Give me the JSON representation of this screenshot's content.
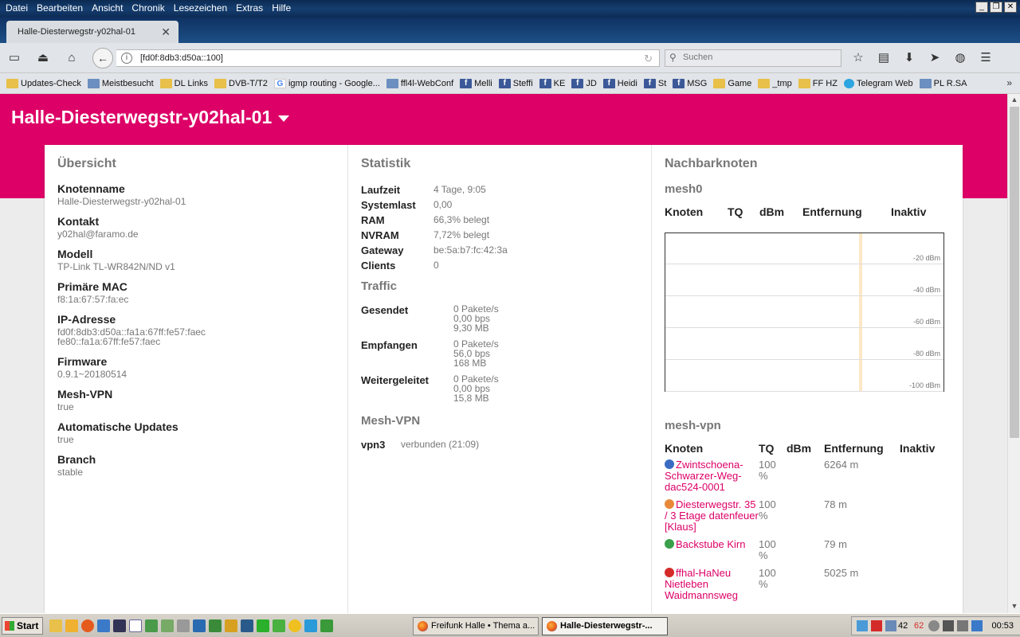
{
  "window": {
    "menu": [
      "Datei",
      "Bearbeiten",
      "Ansicht",
      "Chronik",
      "Lesezeichen",
      "Extras",
      "Hilfe"
    ]
  },
  "tab": {
    "title": "Halle-Diesterwegstr-y02hal-01"
  },
  "navbar": {
    "url": "[fd0f:8db3:d50a::100]",
    "search_placeholder": "Suchen"
  },
  "bookmarks": [
    {
      "label": "Updates-Check",
      "icon": "folder"
    },
    {
      "label": "Meistbesucht",
      "icon": "generic"
    },
    {
      "label": "DL Links",
      "icon": "folder"
    },
    {
      "label": "DVB-T/T2",
      "icon": "folder"
    },
    {
      "label": "igmp routing - Google...",
      "icon": "google"
    },
    {
      "label": "ffl4l-WebConf",
      "icon": "generic"
    },
    {
      "label": "Melli",
      "icon": "facebook"
    },
    {
      "label": "Steffi",
      "icon": "facebook"
    },
    {
      "label": "KE",
      "icon": "facebook"
    },
    {
      "label": "JD",
      "icon": "facebook"
    },
    {
      "label": "Heidi",
      "icon": "facebook"
    },
    {
      "label": "St",
      "icon": "facebook"
    },
    {
      "label": "MSG",
      "icon": "facebook"
    },
    {
      "label": "Game",
      "icon": "folder"
    },
    {
      "label": "_tmp",
      "icon": "folder"
    },
    {
      "label": "FF HZ",
      "icon": "folder"
    },
    {
      "label": "Telegram Web",
      "icon": "telegram"
    },
    {
      "label": "PL R.SA",
      "icon": "generic"
    }
  ],
  "page": {
    "title": "Halle-Diesterwegstr-y02hal-01",
    "overview": {
      "heading": "Übersicht",
      "items": [
        {
          "key": "Knotenname",
          "value": "Halle-Diesterwegstr-y02hal-01"
        },
        {
          "key": "Kontakt",
          "value": "y02hal@faramo.de"
        },
        {
          "key": "Modell",
          "value": "TP-Link TL-WR842N/ND v1"
        },
        {
          "key": "Primäre MAC",
          "value": "f8:1a:67:57:fa:ec"
        },
        {
          "key": "IP-Adresse",
          "value": "fd0f:8db3:d50a::fa1a:67ff:fe57:faec",
          "value2": "fe80::fa1a:67ff:fe57:faec"
        },
        {
          "key": "Firmware",
          "value": "0.9.1~20180514"
        },
        {
          "key": "Mesh-VPN",
          "value": "true"
        },
        {
          "key": "Automatische Updates",
          "value": "true"
        },
        {
          "key": "Branch",
          "value": "stable"
        }
      ]
    },
    "statistics": {
      "heading": "Statistik",
      "rows": [
        {
          "key": "Laufzeit",
          "value": "4 Tage, 9:05"
        },
        {
          "key": "Systemlast",
          "value": "0,00"
        },
        {
          "key": "RAM",
          "value": "66,3% belegt"
        },
        {
          "key": "NVRAM",
          "value": "7,72% belegt"
        },
        {
          "key": "Gateway",
          "value": "be:5a:b7:fc:42:3a"
        },
        {
          "key": "Clients",
          "value": "0"
        }
      ],
      "traffic_heading": "Traffic",
      "traffic": [
        {
          "key": "Gesendet",
          "l1": "0 Pakete/s",
          "l2": "0,00 bps",
          "l3": "9,30 MB"
        },
        {
          "key": "Empfangen",
          "l1": "0 Pakete/s",
          "l2": "56,0 bps",
          "l3": "168 MB"
        },
        {
          "key": "Weitergeleitet",
          "l1": "0 Pakete/s",
          "l2": "0,00 bps",
          "l3": "15,8 MB"
        }
      ],
      "meshvpn_heading": "Mesh-VPN",
      "meshvpn": {
        "key": "vpn3",
        "value": "verbunden (21:09)"
      }
    },
    "neighbours": {
      "heading": "Nachbarknoten",
      "mesh0": {
        "heading": "mesh0",
        "columns": [
          "Knoten",
          "TQ",
          "dBm",
          "Entfernung",
          "Inaktiv"
        ],
        "graph_labels": [
          "-20 dBm",
          "-40 dBm",
          "-60 dBm",
          "-80 dBm",
          "-100 dBm"
        ]
      },
      "meshvpn": {
        "heading": "mesh-vpn",
        "columns": [
          "Knoten",
          "TQ",
          "dBm",
          "Entfernung",
          "Inaktiv"
        ],
        "rows": [
          {
            "node": "Zwintschoena-Schwarzer-Weg-dac524-0001",
            "tq": "100 %",
            "dbm": "",
            "dist": "6264 m",
            "color": "#3b6cc4"
          },
          {
            "node": "Diesterwegstr. 35 / 3 Etage datenfeuer [Klaus]",
            "tq": "100 %",
            "dbm": "",
            "dist": "78 m",
            "color": "#e8893a"
          },
          {
            "node": "Backstube Kirn",
            "tq": "100 %",
            "dbm": "",
            "dist": "79 m",
            "color": "#3aa04a"
          },
          {
            "node": "ffhal-HaNeu Nietleben Waidmannsweg",
            "tq": "100 %",
            "dbm": "",
            "dist": "5025 m",
            "color": "#d42a2a"
          }
        ]
      }
    }
  },
  "taskbar": {
    "start": "Start",
    "buttons": [
      "Freifunk Halle • Thema a...",
      "Halle-Diesterwegstr-..."
    ],
    "tray_nums": [
      "42",
      "62"
    ],
    "time": "00:53"
  }
}
